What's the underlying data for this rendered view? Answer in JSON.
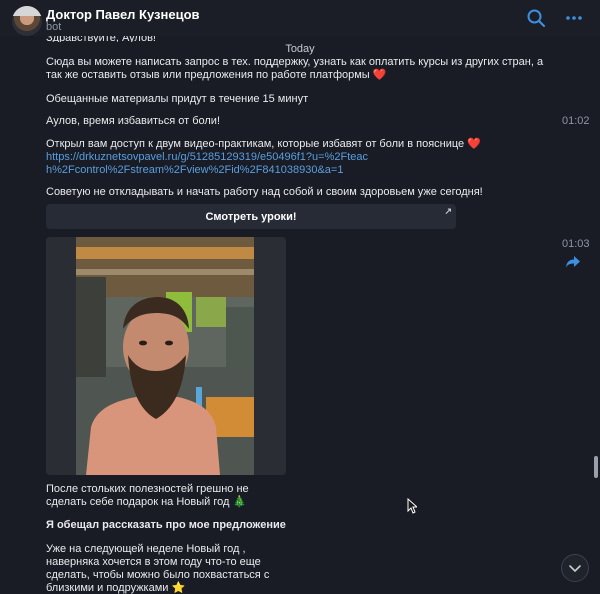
{
  "header": {
    "title": "Доктор Павел Кузнецов",
    "subtitle": "bot",
    "search_icon": "search-icon",
    "more_icon": "more-dots-icon",
    "accent_color": "#3d8fe0"
  },
  "chat": {
    "cutoff_text": "Здравствуйте, Аулов!",
    "date_separator": "Today",
    "messages": [
      {
        "text": "Сюда вы можете написать запрос в тех. поддержку, узнать как оплатить курсы из других стран, а так же оставить отзыв или предложения по работе платформы ❤️"
      },
      {
        "text": "Обещанные материалы придут в течение 15 минут"
      },
      {
        "text": "Аулов, время избавиться от боли!",
        "time": "01:02"
      },
      {
        "text": "Открыл вам доступ к двум видео-практикам, которые избавят от боли в пояснице ❤️",
        "link": "https://drkuznetsovpavel.ru/g/51285129319/e50496f1?u=%2Fteach%2Fcontrol%2Fstream%2Fview%2Fid%2F841038930&a=1"
      },
      {
        "text": "Советую не откладывать и начать работу над собой и своим здоровьем уже сегодня!"
      }
    ],
    "inline_button": {
      "label": "Смотреть уроки!",
      "arrow": "↗"
    },
    "photo_message": {
      "time": "01:03",
      "forward_icon": "share-arrow-icon",
      "photo_icon": "photo-man-with-beard-gym",
      "caption_1": "После стольких полезностей грешно не сделать себе подарок на Новый год 🎄",
      "caption_2": "Я обещал рассказать про мое предложение",
      "caption_3": "Уже на следующей неделе Новый год , наверняка хочется в этом году что-то еще сделать, чтобы можно было похвастаться с близкими и подружками ⭐"
    },
    "scroll_down_icon": "chevron-down-icon"
  }
}
